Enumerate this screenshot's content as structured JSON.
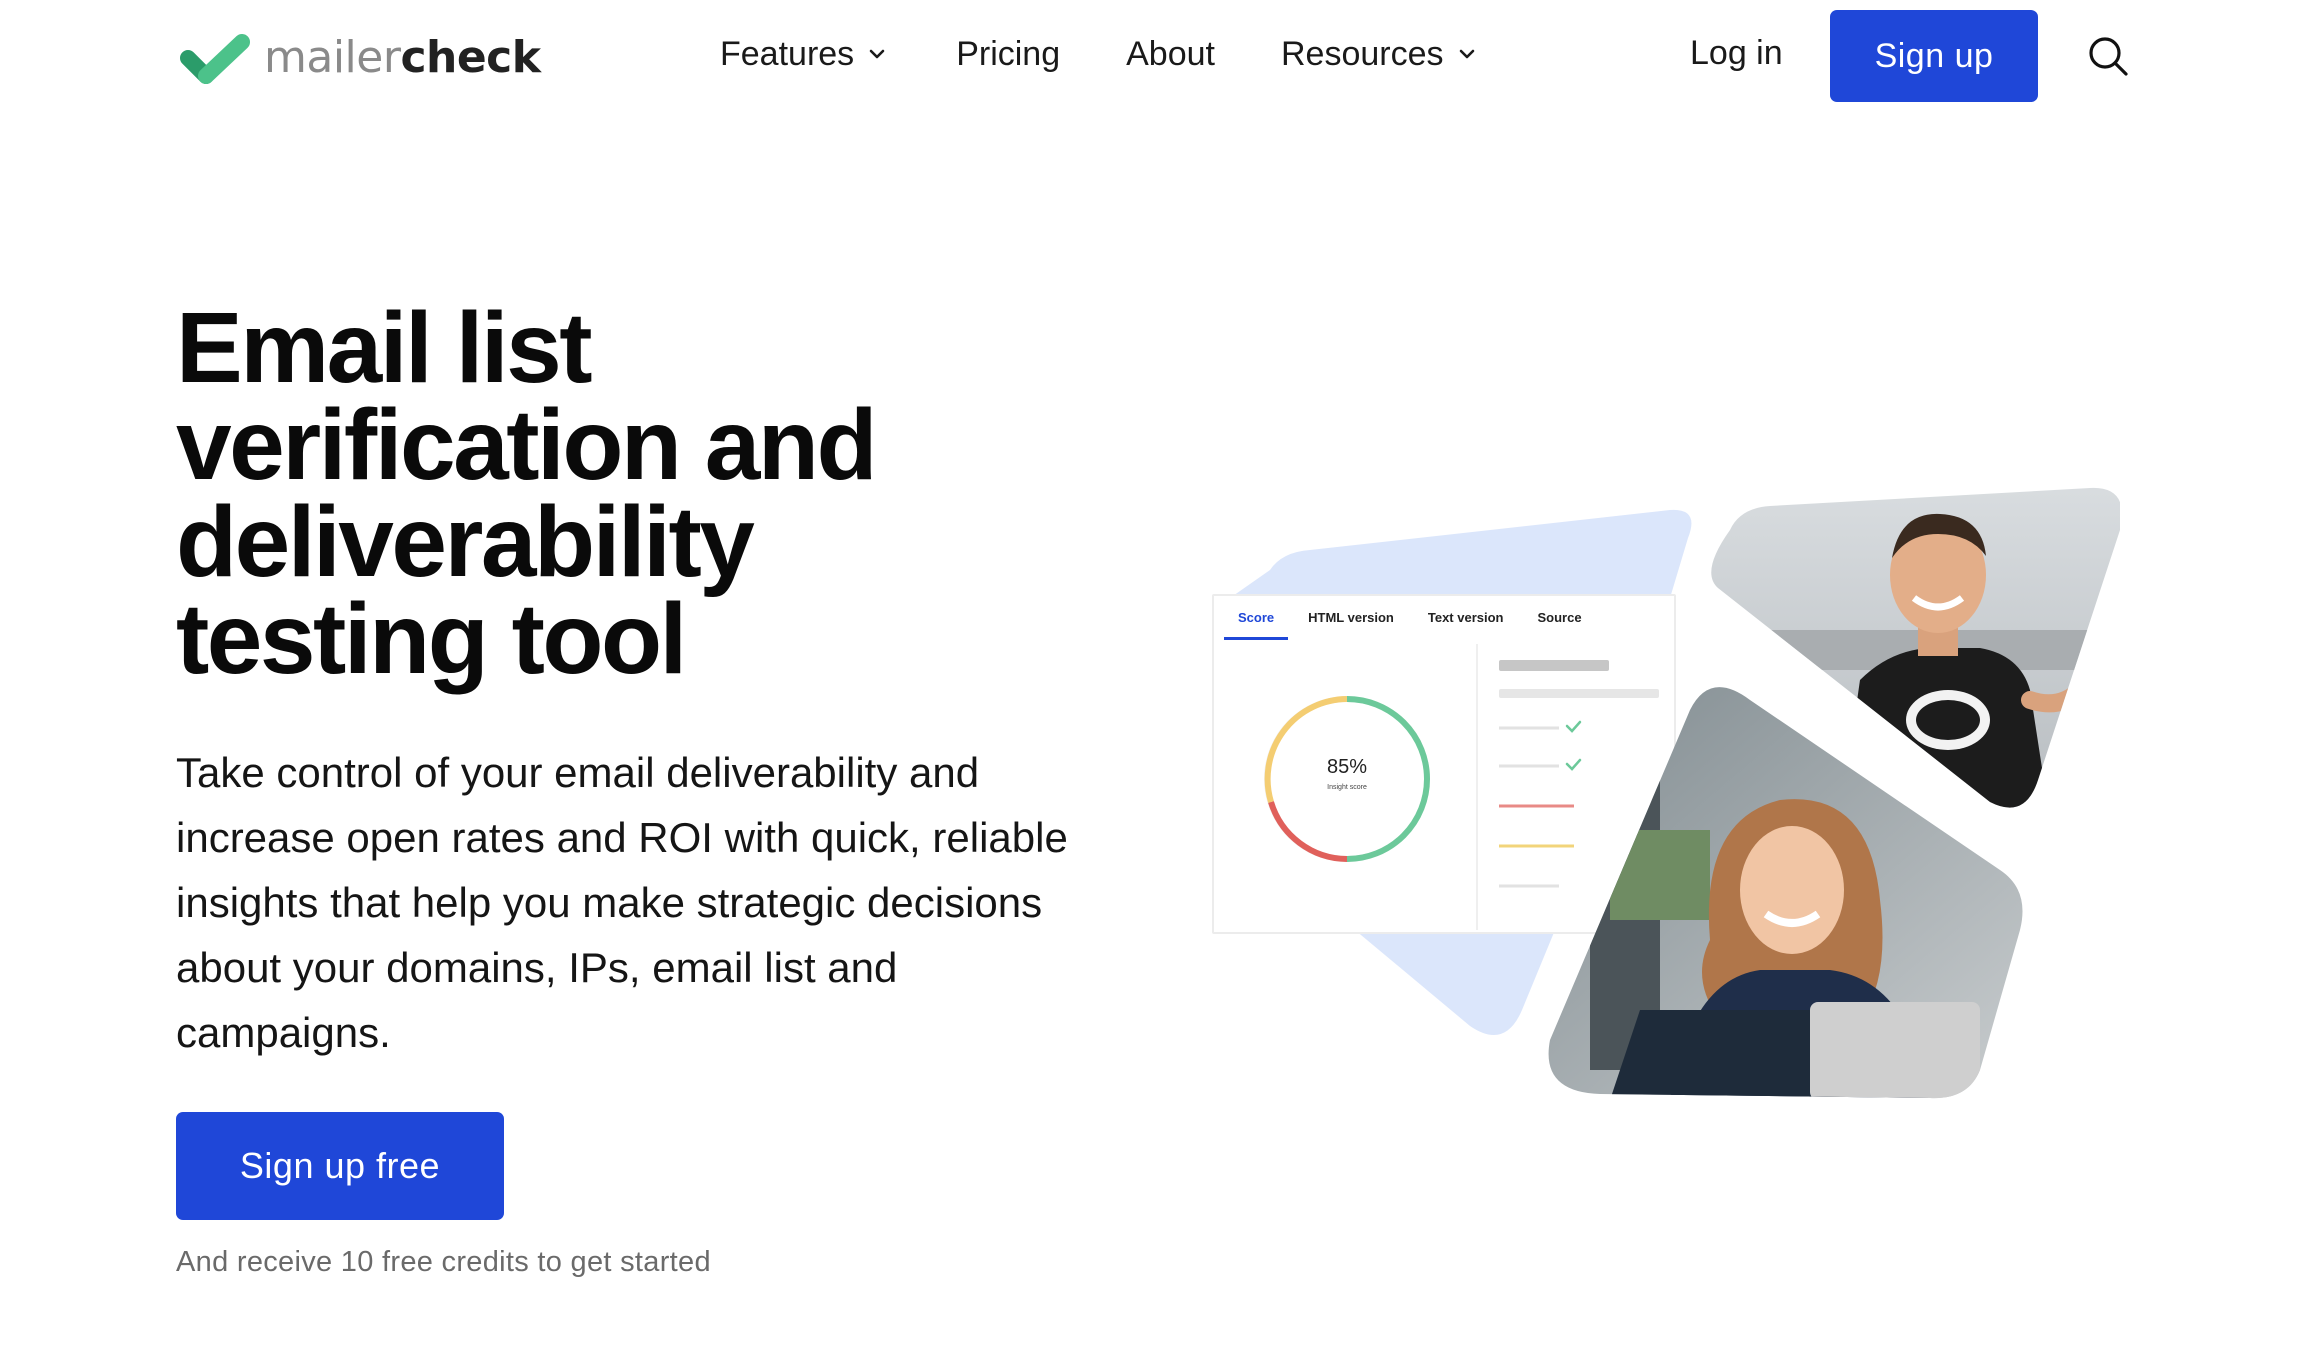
{
  "brand": {
    "name_light": "mailer",
    "name_dark": "check",
    "logo_icon": "checkmark-logo-icon",
    "accent_color": "#1f47d8",
    "logo_green": "#4cc28a"
  },
  "nav": {
    "items": [
      {
        "label": "Features",
        "has_dropdown": true
      },
      {
        "label": "Pricing",
        "has_dropdown": false
      },
      {
        "label": "About",
        "has_dropdown": false
      },
      {
        "label": "Resources",
        "has_dropdown": true
      }
    ],
    "login_label": "Log in",
    "signup_label": "Sign up",
    "search_icon": "search-icon"
  },
  "hero": {
    "title": "Email list verification and deliverability testing tool",
    "description": "Take control of your email deliverability and increase open rates and ROI with quick, reliable insights that help you make strategic decisions about your domains, IPs, email list and campaigns.",
    "cta_label": "Sign up free",
    "cta_note": "And receive 10 free credits to get started"
  },
  "illustration": {
    "tabs": [
      "Score",
      "HTML version",
      "Text version",
      "Source"
    ],
    "active_tab": "Score",
    "score_value": "85%",
    "score_label": "Insight score",
    "score_fraction": 0.85
  }
}
